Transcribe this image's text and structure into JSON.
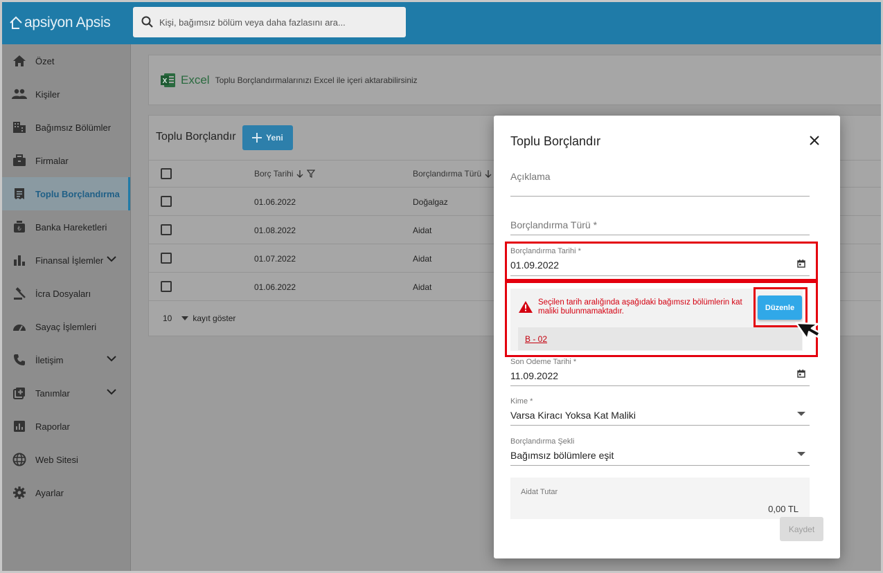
{
  "app": {
    "logo_text": "apsiyon Apsis"
  },
  "search": {
    "placeholder": "Kişi, bağımsız bölüm veya daha fazlasını ara..."
  },
  "sidebar": {
    "items": [
      {
        "label": "Özet",
        "icon": "home-icon"
      },
      {
        "label": "Kişiler",
        "icon": "people-icon"
      },
      {
        "label": "Bağımsız Bölümler",
        "icon": "building-icon"
      },
      {
        "label": "Firmalar",
        "icon": "briefcase-icon"
      },
      {
        "label": "Toplu Borçlandırma",
        "icon": "receipt-icon",
        "active": true
      },
      {
        "label": "Banka Hareketleri",
        "icon": "bank-icon"
      },
      {
        "label": "Finansal İşlemler",
        "icon": "bar-chart-icon",
        "expandable": true
      },
      {
        "label": "İcra Dosyaları",
        "icon": "gavel-icon"
      },
      {
        "label": "Sayaç İşlemleri",
        "icon": "meter-icon"
      },
      {
        "label": "İletişim",
        "icon": "phone-icon",
        "expandable": true
      },
      {
        "label": "Tanımlar",
        "icon": "add-box-icon",
        "expandable": true
      },
      {
        "label": "Raporlar",
        "icon": "report-icon"
      },
      {
        "label": "Web Sitesi",
        "icon": "globe-icon"
      },
      {
        "label": "Ayarlar",
        "icon": "gear-icon"
      }
    ]
  },
  "excel": {
    "title": "Excel",
    "description": "Toplu Borçlandırmalarınızı Excel ile içeri aktarabilirsiniz"
  },
  "list": {
    "title": "Toplu Borçlandır",
    "new_button": "Yeni",
    "columns": [
      "Borç Tarihi",
      "Borçlandırma Türü"
    ],
    "rows": [
      {
        "date": "01.06.2022",
        "type": "Doğalgaz"
      },
      {
        "date": "01.08.2022",
        "type": "Aidat"
      },
      {
        "date": "01.07.2022",
        "type": "Aidat"
      },
      {
        "date": "01.06.2022",
        "type": "Aidat"
      }
    ],
    "page_size": "10",
    "page_size_label": "kayıt göster"
  },
  "modal": {
    "title": "Toplu Borçlandır",
    "aciklama_placeholder": "Açıklama",
    "tur_placeholder": "Borçlandırma Türü *",
    "tarih_label": "Borçlandırma Tarihi *",
    "tarih_value": "01.09.2022",
    "warning_text": "Seçilen tarih aralığında aşağıdaki bağımsız bölümlerin kat maliki bulunmamaktadır.",
    "edit_button": "Düzenle",
    "unit_link": "B - 02",
    "son_odeme_label": "Son Odeme Tarihi *",
    "son_odeme_value": "11.09.2022",
    "kime_label": "Kime *",
    "kime_value": "Varsa Kiracı Yoksa Kat Maliki",
    "sekil_label": "Borçlandırma Şekli",
    "sekil_value": "Bağımsız bölümlere eşit",
    "aidat_label": "Aidat Tutar",
    "aidat_value": "0,00 TL",
    "save_button": "Kaydet"
  },
  "colors": {
    "topbar": "#1f7ba8",
    "accent": "#30a8e8",
    "highlight": "#e4000e",
    "warning_text": "#d40010"
  }
}
